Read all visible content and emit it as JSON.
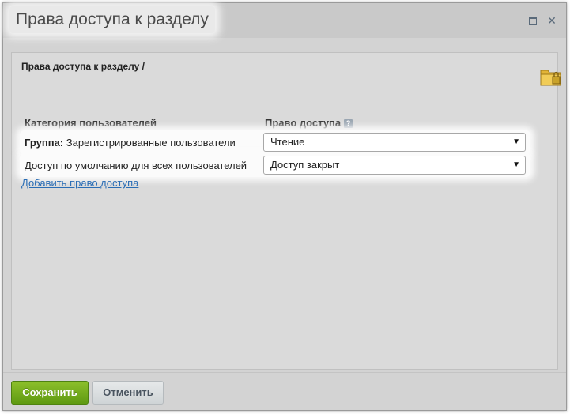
{
  "window": {
    "title": "Права доступа к разделу",
    "maximize_icon": "maximize-icon",
    "close_icon": "close-icon",
    "close_glyph": "✕"
  },
  "breadcrumb": "Права доступа к разделу /",
  "table": {
    "col_category": "Категория пользователей",
    "col_access": "Право доступа",
    "help_glyph": "?",
    "rows": [
      {
        "label_bold": "Группа:",
        "label": "Зарегистрированные пользователи",
        "value": "Чтение"
      },
      {
        "label_bold": "",
        "label": "Доступ по умолчанию для всех пользователей",
        "value": "Доступ закрыт"
      }
    ],
    "arrow_glyph": "▼"
  },
  "add_link": "Добавить право доступа",
  "buttons": {
    "save": "Сохранить",
    "cancel": "Отменить"
  },
  "colors": {
    "save_button": "#6ea81c",
    "link": "#2a6db5",
    "dialog_bg": "#d3d3d3"
  }
}
